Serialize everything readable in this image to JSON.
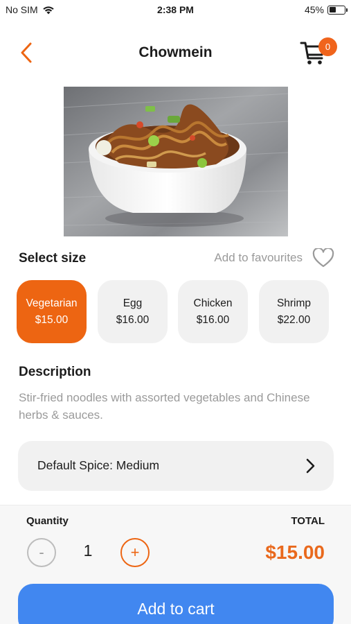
{
  "status_bar": {
    "carrier": "No SIM",
    "time": "2:38 PM",
    "battery_percent": "45%",
    "battery_level": 0.45
  },
  "nav": {
    "title": "Chowmein",
    "cart_count": "0",
    "back_icon": "chevron-left-icon",
    "cart_icon": "cart-icon"
  },
  "product": {
    "image": "chowmein-bowl-photo"
  },
  "sizes": {
    "heading": "Select size",
    "favourite_label": "Add to favourites",
    "options": [
      {
        "name": "Vegetarian",
        "price": "$15.00",
        "selected": true
      },
      {
        "name": "Egg",
        "price": "$16.00",
        "selected": false
      },
      {
        "name": "Chicken",
        "price": "$16.00",
        "selected": false
      },
      {
        "name": "Shrimp",
        "price": "$22.00",
        "selected": false
      }
    ]
  },
  "description": {
    "heading": "Description",
    "text": "Stir-fried noodles with assorted vegetables and Chinese herbs & sauces."
  },
  "spice": {
    "label": "Default Spice: Medium"
  },
  "order": {
    "quantity_label": "Quantity",
    "quantity": "1",
    "total_label": "TOTAL",
    "total": "$15.00",
    "add_button": "Add to cart"
  },
  "colors": {
    "accent_orange": "#ed6512",
    "primary_blue": "#4187f0",
    "muted_text": "#9a9a9a",
    "card_bg": "#f1f1f1"
  }
}
